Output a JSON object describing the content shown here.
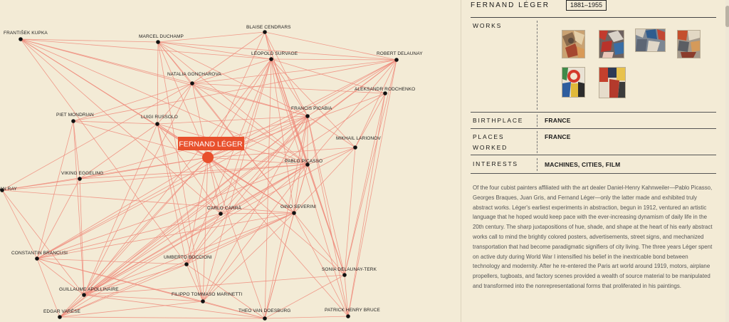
{
  "network": {
    "focus": {
      "name": "FERNAND LÉGER"
    },
    "nodes": [
      {
        "name": "FRANTIŠEK KUPKA"
      },
      {
        "name": "MARCEL DUCHAMP"
      },
      {
        "name": "BLAISE CENDRARS"
      },
      {
        "name": "LÉOPOLD SURVAGE"
      },
      {
        "name": "ROBERT DELAUNAY"
      },
      {
        "name": "NATALIA GONCHAROVA"
      },
      {
        "name": "ALEKSANDR RODCHENKO"
      },
      {
        "name": "PIET MONDRIAN"
      },
      {
        "name": "LUIGI RUSSOLO"
      },
      {
        "name": "FRANCIS PICABIA"
      },
      {
        "name": "MIKHAIL LARIONOV"
      },
      {
        "name": "PABLO PICASSO"
      },
      {
        "name": "VIKING EGGELING"
      },
      {
        "name": "MAN RAY"
      },
      {
        "name": "CARLO CARRÀ"
      },
      {
        "name": "GINO SEVERINI"
      },
      {
        "name": "CONSTANTIN BRANCUSI"
      },
      {
        "name": "UMBERTO BOCCIONI"
      },
      {
        "name": "SONIA DELAUNAY-TERK"
      },
      {
        "name": "GUILLAUME APOLLINAIRE"
      },
      {
        "name": "FILIPPO TOMMASO MARINETTI"
      },
      {
        "name": "EDGAR VARÈSE"
      },
      {
        "name": "THEO VAN DOESBURG"
      },
      {
        "name": "PATRICK HENRY BRUCE"
      }
    ]
  },
  "colors": {
    "focus": "#e8502c",
    "edge": "#ee8a7a",
    "node": "#111111",
    "text": "#1e1e1e"
  },
  "artist": {
    "name": "FERNAND LÉGER",
    "dates": "1881–1955",
    "works_label": "WORKS",
    "birthplace_label": "BIRTHPLACE",
    "birthplace": "FRANCE",
    "places_label_1": "PLACES",
    "places_label_2": "WORKED",
    "places": "FRANCE",
    "interests_label": "INTERESTS",
    "interests": "MACHINES, CITIES, FILM",
    "bio": "Of the four cubist painters affiliated with the art dealer Daniel-Henry Kahnweiler—Pablo Picasso, Georges Braques, Juan Gris, and Fernand Léger—only the latter made and exhibited truly abstract works. Léger's earliest experiments in abstraction, begun in 1912, ventured an artistic language that he hoped would keep pace with the ever-increasing dynamism of daily life in the 20th century. The sharp juxtapositions of hue, shade, and shape at the heart of his early abstract works call to mind the brightly colored posters, advertisements, street signs, and mechanized transportation that had become paradigmatic signifiers of city living. The three years Léger spent on active duty during World War I intensified his belief in the inextricable bond between technology and modernity. After he re-entered the Paris art world around 1919, motors, airplane propellers, tugboats, and factory scenes provided a wealth of source material to be manipulated and transformed into the nonrepresentational forms that proliferated in his paintings."
  }
}
